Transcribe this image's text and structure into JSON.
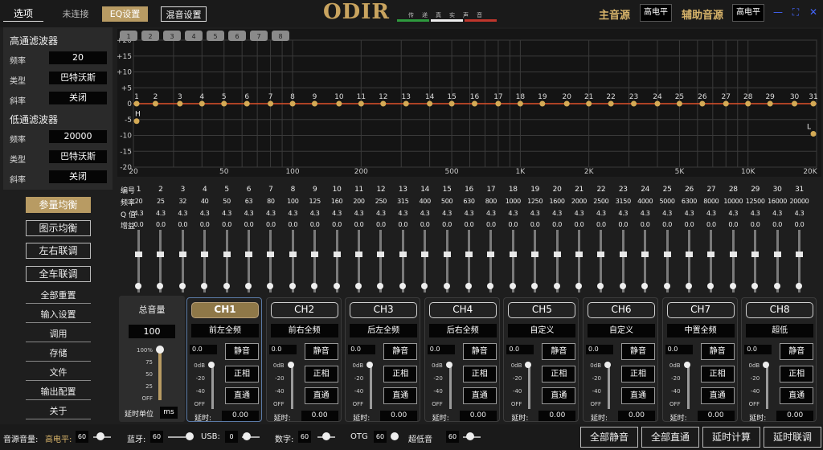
{
  "topbar": {
    "tab_options": "选项",
    "status_unconnected": "未连接",
    "tab_eq": "EQ设置",
    "tab_mix": "混音设置",
    "logo": "ODIR",
    "slogan": "传递真实声音",
    "main_source_label": "主音源",
    "main_source_value": "高电平",
    "aux_source_label": "辅助音源",
    "aux_source_value": "高电平",
    "colors": {
      "accent": "#b89b63",
      "logo": "#c9a45f",
      "stripe_green": "#2e9a3e",
      "stripe_white": "#eeeeee",
      "stripe_red": "#c0362c"
    }
  },
  "filters": {
    "hp_title": "高通滤波器",
    "hp_freq_label": "频率",
    "hp_freq": "20",
    "hp_type_label": "类型",
    "hp_type": "巴特沃斯",
    "hp_slope_label": "斜率",
    "hp_slope": "关闭",
    "lp_title": "低通滤波器",
    "lp_freq_label": "频率",
    "lp_freq": "20000",
    "lp_type_label": "类型",
    "lp_type": "巴特沃斯",
    "lp_slope_label": "斜率",
    "lp_slope": "关闭"
  },
  "nav": {
    "param_eq": "参量均衡",
    "graphic_eq": "图示均衡",
    "lr_link": "左右联调",
    "car_link": "全车联调"
  },
  "menu": [
    "全部重置",
    "输入设置",
    "调用",
    "存储",
    "文件",
    "输出配置",
    "关于"
  ],
  "graph": {
    "presets": [
      "1",
      "2",
      "3",
      "4",
      "5",
      "6",
      "7",
      "8"
    ],
    "y_ticks": [
      "+20",
      "+15",
      "+10",
      "+5",
      "0",
      "-5",
      "-10",
      "-15",
      "-20"
    ],
    "x_ticks": [
      "20",
      "50",
      "100",
      "200",
      "500",
      "1K",
      "2K",
      "5K",
      "10K",
      "20K"
    ],
    "band_labels": [
      "1",
      "2",
      "3",
      "4",
      "5",
      "6",
      "7",
      "8",
      "9",
      "10",
      "11",
      "12",
      "13",
      "14",
      "15",
      "16",
      "17",
      "18",
      "19",
      "20",
      "21",
      "22",
      "23",
      "24",
      "25",
      "26",
      "27",
      "28",
      "29",
      "30",
      "31"
    ],
    "hp_marker": "H",
    "lp_marker": "L",
    "curve_color": "#e0522a",
    "marker_color": "#d4aa55"
  },
  "eq": {
    "row_labels": [
      "编号",
      "频率",
      "Q 值",
      "增益"
    ],
    "bands": [
      {
        "n": "1",
        "f": "20",
        "q": "4.3",
        "g": "0.0"
      },
      {
        "n": "2",
        "f": "25",
        "q": "4.3",
        "g": "0.0"
      },
      {
        "n": "3",
        "f": "32",
        "q": "4.3",
        "g": "0.0"
      },
      {
        "n": "4",
        "f": "40",
        "q": "4.3",
        "g": "0.0"
      },
      {
        "n": "5",
        "f": "50",
        "q": "4.3",
        "g": "0.0"
      },
      {
        "n": "6",
        "f": "63",
        "q": "4.3",
        "g": "0.0"
      },
      {
        "n": "7",
        "f": "80",
        "q": "4.3",
        "g": "0.0"
      },
      {
        "n": "8",
        "f": "100",
        "q": "4.3",
        "g": "0.0"
      },
      {
        "n": "9",
        "f": "125",
        "q": "4.3",
        "g": "0.0"
      },
      {
        "n": "10",
        "f": "160",
        "q": "4.3",
        "g": "0.0"
      },
      {
        "n": "11",
        "f": "200",
        "q": "4.3",
        "g": "0.0"
      },
      {
        "n": "12",
        "f": "250",
        "q": "4.3",
        "g": "0.0"
      },
      {
        "n": "13",
        "f": "315",
        "q": "4.3",
        "g": "0.0"
      },
      {
        "n": "14",
        "f": "400",
        "q": "4.3",
        "g": "0.0"
      },
      {
        "n": "15",
        "f": "500",
        "q": "4.3",
        "g": "0.0"
      },
      {
        "n": "16",
        "f": "630",
        "q": "4.3",
        "g": "0.0"
      },
      {
        "n": "17",
        "f": "800",
        "q": "4.3",
        "g": "0.0"
      },
      {
        "n": "18",
        "f": "1000",
        "q": "4.3",
        "g": "0.0"
      },
      {
        "n": "19",
        "f": "1250",
        "q": "4.3",
        "g": "0.0"
      },
      {
        "n": "20",
        "f": "1600",
        "q": "4.3",
        "g": "0.0"
      },
      {
        "n": "21",
        "f": "2000",
        "q": "4.3",
        "g": "0.0"
      },
      {
        "n": "22",
        "f": "2500",
        "q": "4.3",
        "g": "0.0"
      },
      {
        "n": "23",
        "f": "3150",
        "q": "4.3",
        "g": "0.0"
      },
      {
        "n": "24",
        "f": "4000",
        "q": "4.3",
        "g": "0.0"
      },
      {
        "n": "25",
        "f": "5000",
        "q": "4.3",
        "g": "0.0"
      },
      {
        "n": "26",
        "f": "6300",
        "q": "4.3",
        "g": "0.0"
      },
      {
        "n": "27",
        "f": "8000",
        "q": "4.3",
        "g": "0.0"
      },
      {
        "n": "28",
        "f": "10000",
        "q": "4.3",
        "g": "0.0"
      },
      {
        "n": "29",
        "f": "12500",
        "q": "4.3",
        "g": "0.0"
      },
      {
        "n": "30",
        "f": "16000",
        "q": "4.3",
        "g": "0.0"
      },
      {
        "n": "31",
        "f": "20000",
        "q": "4.3",
        "g": "0.0"
      }
    ]
  },
  "master": {
    "title": "总音量",
    "value": "100",
    "scale": [
      "100%",
      "75",
      "50",
      "25",
      "OFF"
    ],
    "level": 1.0,
    "delay_unit_label": "延时单位",
    "delay_unit": "ms"
  },
  "channels": [
    {
      "id": "CH1",
      "name": "前左全频",
      "gain": "0.0",
      "delay": "0.00",
      "level": 1.0
    },
    {
      "id": "CH2",
      "name": "前右全频",
      "gain": "0.0",
      "delay": "0.00",
      "level": 1.0
    },
    {
      "id": "CH3",
      "name": "后左全频",
      "gain": "0.0",
      "delay": "0.00",
      "level": 1.0
    },
    {
      "id": "CH4",
      "name": "后右全频",
      "gain": "0.0",
      "delay": "0.00",
      "level": 1.0
    },
    {
      "id": "CH5",
      "name": "自定义",
      "gain": "0.0",
      "delay": "0.00",
      "level": 1.0
    },
    {
      "id": "CH6",
      "name": "自定义",
      "gain": "0.0",
      "delay": "0.00",
      "level": 1.0
    },
    {
      "id": "CH7",
      "name": "中置全频",
      "gain": "0.0",
      "delay": "0.00",
      "level": 1.0
    },
    {
      "id": "CH8",
      "name": "超低",
      "gain": "0.0",
      "delay": "0.00",
      "level": 1.0
    }
  ],
  "channel_ui": {
    "mute": "静音",
    "phase": "正相",
    "direct": "直通",
    "delay_label": "延时:",
    "scale": [
      "0dB",
      "-20",
      "-40",
      "OFF"
    ]
  },
  "bottom": {
    "source_vol_label": "音源音量:",
    "high_label": "高电平:",
    "high_val": "60",
    "bt_label": "蓝牙:",
    "bt_val": "60",
    "usb_label": "USB:",
    "usb_val": "0",
    "digital_label": "数字:",
    "digital_val": "60",
    "otg_label": "OTG",
    "otg_val": "60",
    "sub_label": "超低音",
    "sub_val": "60",
    "btn_all_mute": "全部静音",
    "btn_all_direct": "全部直通",
    "btn_delay_calc": "延时计算",
    "btn_delay_link": "延时联调"
  }
}
